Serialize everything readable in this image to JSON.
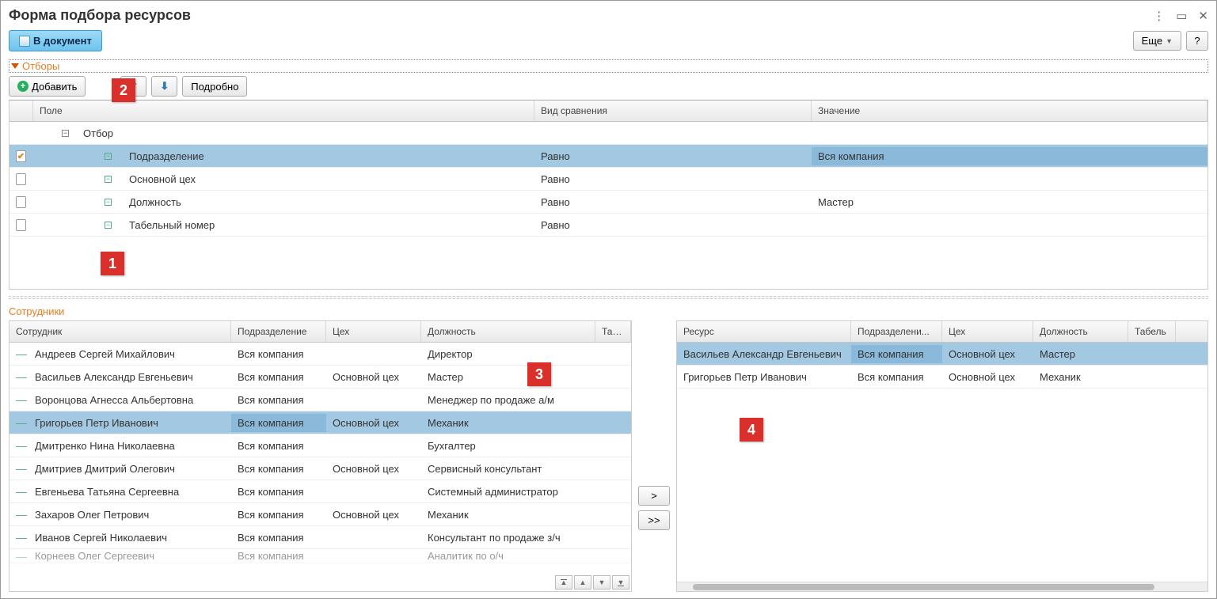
{
  "window": {
    "title": "Форма подбора ресурсов",
    "to_document_btn": "В документ",
    "more_btn": "Еще",
    "help_btn": "?"
  },
  "filters": {
    "section_title": "Отборы",
    "add_btn": "Добавить",
    "detail_btn": "Подробно",
    "columns": {
      "field": "Поле",
      "cmp": "Вид сравнения",
      "val": "Значение"
    },
    "root_label": "Отбор",
    "rows": [
      {
        "checked": true,
        "field": "Подразделение",
        "cmp": "Равно",
        "val": "Вся компания",
        "selected": true
      },
      {
        "checked": false,
        "field": "Основной цех",
        "cmp": "Равно",
        "val": ""
      },
      {
        "checked": false,
        "field": "Должность",
        "cmp": "Равно",
        "val": "Мастер"
      },
      {
        "checked": false,
        "field": "Табельный номер",
        "cmp": "Равно",
        "val": ""
      }
    ]
  },
  "employees": {
    "section_title": "Сотрудники",
    "columns": {
      "emp": "Сотрудник",
      "dept": "Подразделение",
      "shop": "Цех",
      "pos": "Должность",
      "tab": "Таб..."
    },
    "rows": [
      {
        "name": "Андреев Сергей Михайлович",
        "dept": "Вся компания",
        "shop": "",
        "pos": "Директор"
      },
      {
        "name": "Васильев Александр Евгеньевич",
        "dept": "Вся компания",
        "shop": "Основной цех",
        "pos": "Мастер"
      },
      {
        "name": "Воронцова Агнесса Альбертовна",
        "dept": "Вся компания",
        "shop": "",
        "pos": "Менеджер по продаже а/м"
      },
      {
        "name": "Григорьев Петр Иванович",
        "dept": "Вся компания",
        "shop": "Основной цех",
        "pos": "Механик",
        "selected": true
      },
      {
        "name": "Дмитренко Нина Николаевна",
        "dept": "Вся компания",
        "shop": "",
        "pos": "Бухгалтер"
      },
      {
        "name": "Дмитриев Дмитрий Олегович",
        "dept": "Вся компания",
        "shop": "Основной цех",
        "pos": "Сервисный консультант"
      },
      {
        "name": "Евгеньева Татьяна Сергеевна",
        "dept": "Вся компания",
        "shop": "",
        "pos": "Системный администратор"
      },
      {
        "name": "Захаров Олег Петрович",
        "dept": "Вся компания",
        "shop": "Основной цех",
        "pos": "Механик"
      },
      {
        "name": "Иванов Сергей Николаевич",
        "dept": "Вся компания",
        "shop": "",
        "pos": "Консультант по продаже з/ч"
      },
      {
        "name": "Корнеев Олег Сергеевич",
        "dept": "Вся компания",
        "shop": "",
        "pos": "Аналитик по о/ч",
        "cut": true
      }
    ]
  },
  "transfer": {
    "one": ">",
    "all": ">>"
  },
  "resources": {
    "columns": {
      "res": "Ресурс",
      "dept": "Подразделени...",
      "shop": "Цех",
      "pos": "Должность",
      "tab": "Табель"
    },
    "rows": [
      {
        "name": "Васильев Александр Евгеньевич",
        "dept": "Вся компания",
        "shop": "Основной цех",
        "pos": "Мастер",
        "selected": true
      },
      {
        "name": "Григорьев Петр Иванович",
        "dept": "Вся компания",
        "shop": "Основной цех",
        "pos": "Механик"
      }
    ]
  },
  "callouts": {
    "c1": "1",
    "c2": "2",
    "c3": "3",
    "c4": "4"
  }
}
